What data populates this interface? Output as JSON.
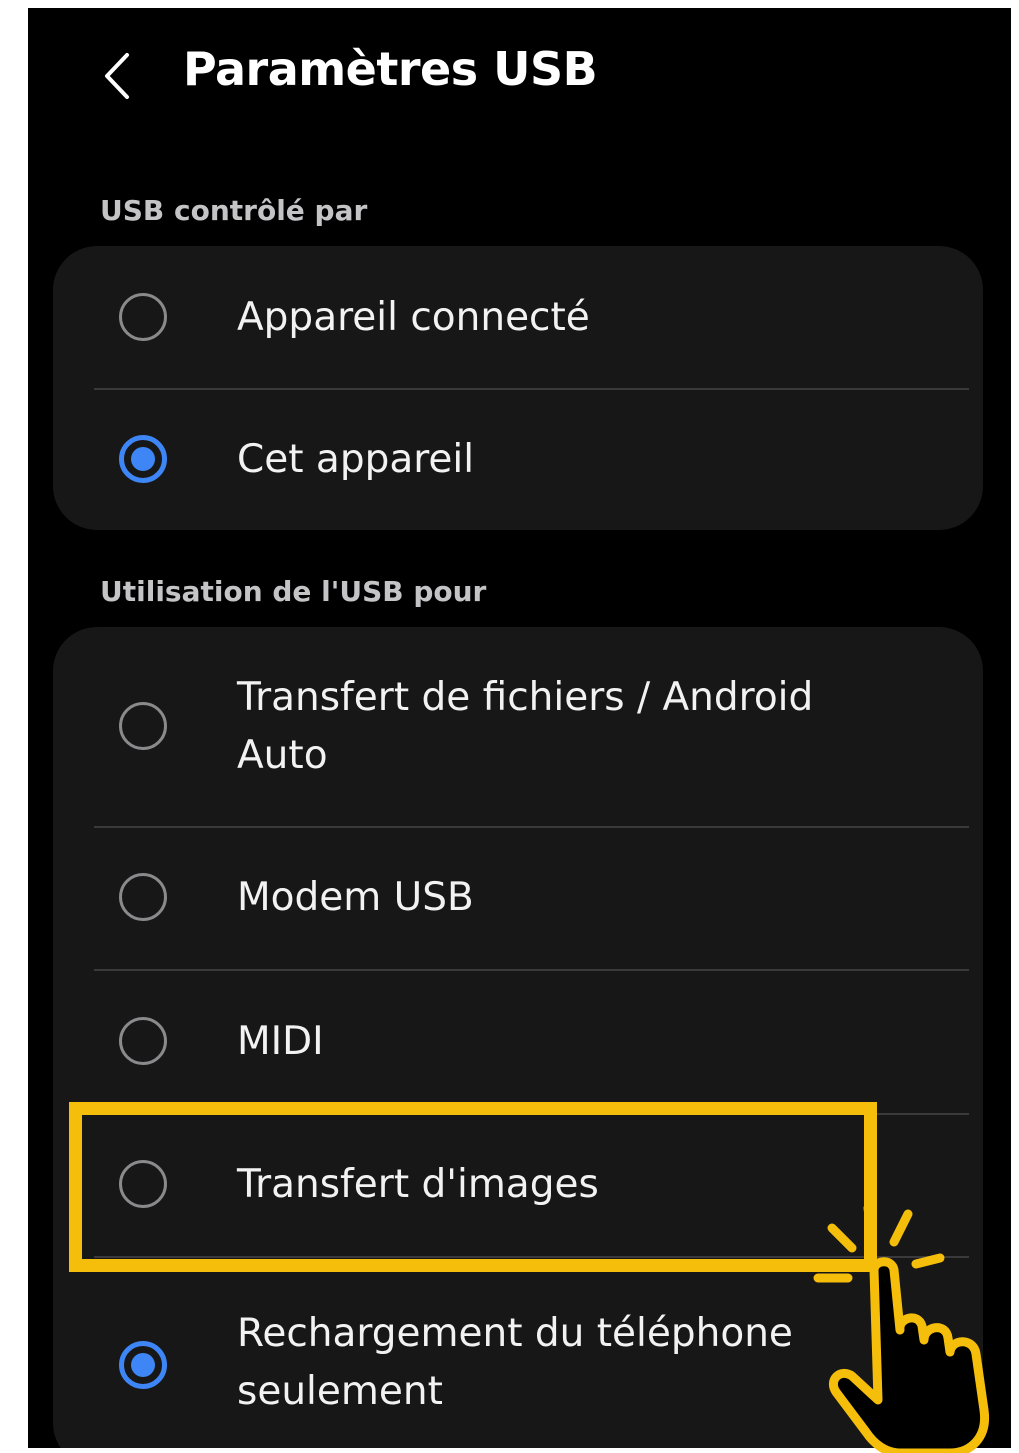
{
  "header": {
    "title": "Paramètres USB"
  },
  "sections": [
    {
      "label": "USB contrôlé par",
      "options": [
        {
          "label": "Appareil connecté",
          "selected": false
        },
        {
          "label": "Cet appareil",
          "selected": true
        }
      ]
    },
    {
      "label": "Utilisation de l'USB pour",
      "options": [
        {
          "label": "Transfert de fichiers / Android Auto",
          "selected": false
        },
        {
          "label": "Modem USB",
          "selected": false
        },
        {
          "label": "MIDI",
          "selected": false
        },
        {
          "label": "Transfert d'images",
          "selected": false,
          "highlighted": true
        },
        {
          "label": "Rechargement du téléphone seulement",
          "selected": true
        }
      ]
    }
  ],
  "colors": {
    "accent": "#3e86f5",
    "highlight": "#f5be0b",
    "card": "#171717",
    "background": "#000000"
  },
  "icons": {
    "back": "chevron-left-icon",
    "pointer": "hand-pointer-icon"
  }
}
